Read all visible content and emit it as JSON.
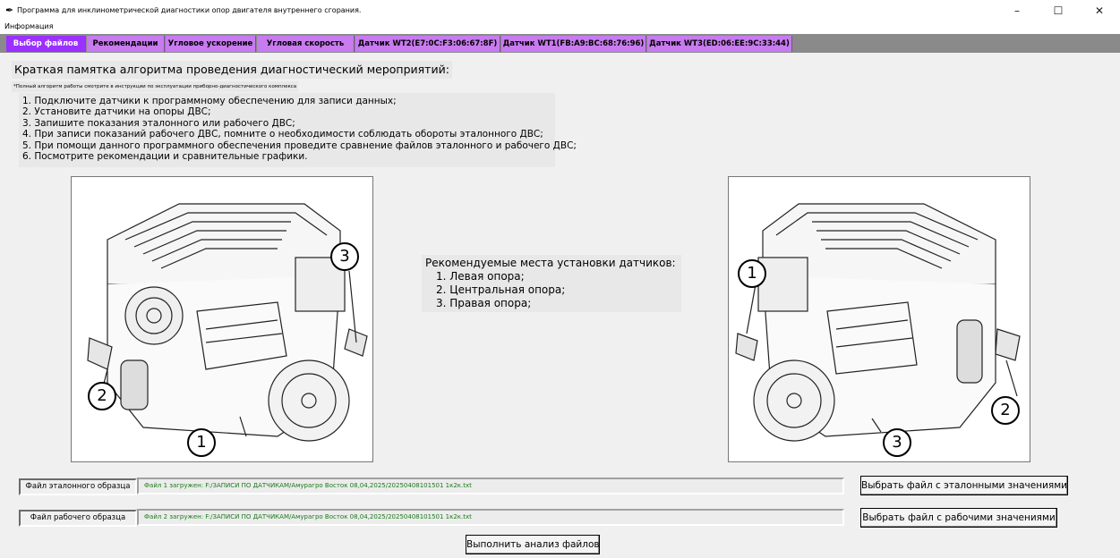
{
  "window": {
    "title": "Программа для инклинометрической диагностики опор двигателя внутреннего сгорания.",
    "icon": "feather-icon",
    "controls": {
      "minimize": "–",
      "maximize": "☐",
      "close": "✕"
    }
  },
  "menu": {
    "items": [
      "Информация"
    ]
  },
  "tabs": [
    {
      "label": "Выбор файлов",
      "active": true
    },
    {
      "label": "Рекомендации",
      "active": false
    },
    {
      "label": "Угловое ускорение",
      "active": false
    },
    {
      "label": "Угловая скорость",
      "active": false
    },
    {
      "label": "Датчик WT2(E7:0C:F3:06:67:8F)",
      "active": false
    },
    {
      "label": "Датчик WT1(FB:A9:BC:68:76:96)",
      "active": false
    },
    {
      "label": "Датчик WT3(ED:06:EE:9C:33:44)",
      "active": false
    }
  ],
  "memo": {
    "title": "Краткая памятка алгоритма проведения диагностический мероприятий:",
    "note": "*Полный алгоритм работы смотрите в инструкции по эксплуатации приборно-диагностического комплекса",
    "steps": [
      "1. Подключите датчики к программному обеспечению для записи данных;",
      "2. Установите датчики на опоры ДВС;",
      "3. Запишите показания эталонного или рабочего ДВС;",
      "4. При записи показаний рабочего ДВС, помните о необходимости соблюдать обороты эталонного ДВС;",
      "5. При помощи данного программного обеспечения проведите сравнение файлов эталонного и рабочего ДВС;",
      "6. Посмотрите рекомендации и сравнительные графики."
    ]
  },
  "recommendation": {
    "title": "Рекомендуемые места установки датчиков:",
    "items": [
      "1. Левая опора;",
      "2. Центральная опора;",
      "3. Правая опора;"
    ]
  },
  "left_image": {
    "markers": [
      "3",
      "2",
      "1"
    ]
  },
  "right_image": {
    "markers": [
      "1",
      "2",
      "3"
    ]
  },
  "files": {
    "reference_label": "Файл эталонного образца",
    "reference_status": "Файл 1 загружен: F:/ЗАПИСИ ПО ДАТЧИКАМ/Амурагро Восток 08,04,2025/20250408101501 1к2к.txt",
    "reference_button": "Выбрать файл с эталонными значениями",
    "working_label": "Файл рабочего образца",
    "working_status": "Файл 2 загружен: F:/ЗАПИСИ ПО ДАТЧИКАМ/Амурагро Восток 08,04,2025/20250408101501 1к2к.txt",
    "working_button": "Выбрать файл с рабочими значениями",
    "analyze_button": "Выполнить анализ файлов"
  },
  "colors": {
    "tab_active": "#9b30ff",
    "tab_inactive": "#c77bef",
    "tabbar_bg": "#8a8a8a",
    "status_text": "#1a7a1a",
    "window_bg": "#f0f0f0"
  }
}
